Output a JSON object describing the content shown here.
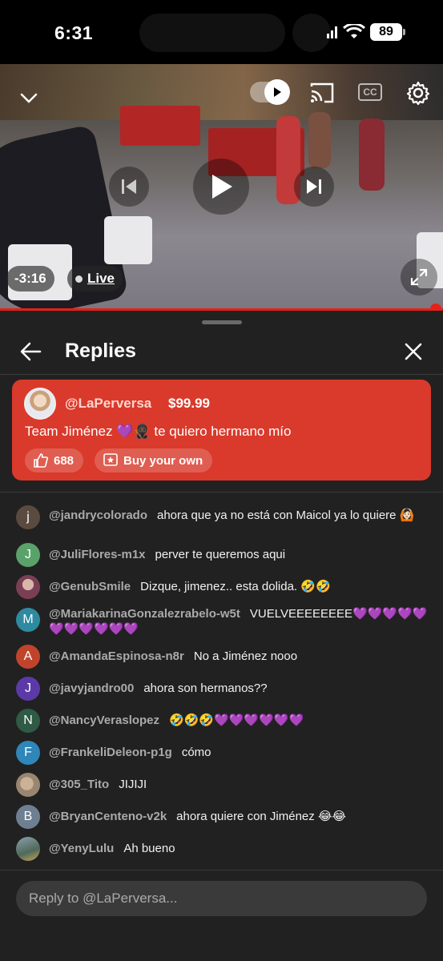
{
  "status": {
    "time": "6:31",
    "battery": "89"
  },
  "video": {
    "remaining": "-3:16",
    "live_label": "Live",
    "cc_label": "CC",
    "colors": {
      "progress": "#e62117"
    }
  },
  "panel": {
    "title": "Replies",
    "superchat": {
      "username": "@LaPerversa",
      "amount": "$99.99",
      "message": "Team Jiménez 💜🥷🏿 te quiero hermano mío",
      "likes": "688",
      "buy_label": "Buy your own",
      "color": "#d93a2b"
    },
    "comments": [
      {
        "user": "@jandrycolorado",
        "text": "ahora que ya no está con Maicol ya lo quiere 🙆🏻",
        "initial": "j",
        "color": "#5b4a3f"
      },
      {
        "user": "@JuliFlores-m1x",
        "text": "perver te queremos aqui",
        "initial": "J",
        "color": "#5aa26a"
      },
      {
        "user": "@GenubSmile",
        "text": "Dizque, jimenez.. esta dolida. 🤣🤣",
        "initial": "",
        "color": "#7a3f55"
      },
      {
        "user": "@MariakarinaGonzalezrabelo-w5t",
        "text": "VUELVEEEEEEEE💜💜💜💜💜💜💜💜💜💜💜",
        "initial": "M",
        "color": "#2e8aa0"
      },
      {
        "user": "@AmandaEspinosa-n8r",
        "text": "No a Jiménez nooo",
        "initial": "A",
        "color": "#c0442c"
      },
      {
        "user": "@javyjandro00",
        "text": "ahora son hermanos??",
        "initial": "J",
        "color": "#5b3aa8"
      },
      {
        "user": "@NancyVeraslopez",
        "text": "🤣🤣🤣💜💜💜💜💜💜",
        "initial": "N",
        "color": "#2f5a45"
      },
      {
        "user": "@FrankeliDeleon-p1g",
        "text": "cómo",
        "initial": "F",
        "color": "#2f86b8"
      },
      {
        "user": "@305_Tito",
        "text": "JIJIJI",
        "initial": "",
        "color": "#9a8670"
      },
      {
        "user": "@BryanCenteno-v2k",
        "text": "ahora quiere con Jiménez 😂😂",
        "initial": "B",
        "color": "#6f7f92"
      },
      {
        "user": "@YenyLulu",
        "text": "Ah bueno",
        "initial": "",
        "color": "#4f6a5a"
      }
    ],
    "reply_placeholder": "Reply to @LaPerversa..."
  }
}
